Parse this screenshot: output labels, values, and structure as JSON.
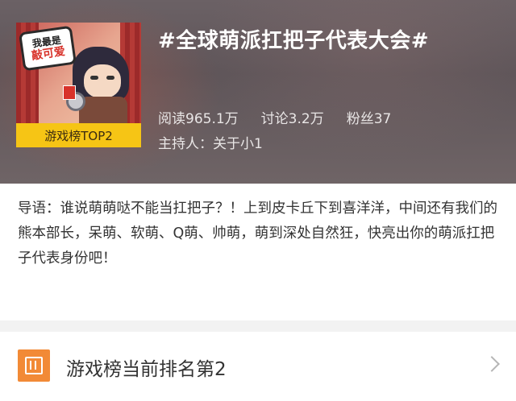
{
  "header": {
    "title": "#全球萌派扛把子代表大会#",
    "cover": {
      "bubble_line1": "我最是",
      "bubble_line2": "敲可爱",
      "rank_badge": "游戏榜TOP2"
    },
    "stats": {
      "reads": "阅读965.1万",
      "discussions": "讨论3.2万",
      "fans": "粉丝37"
    },
    "host": "主持人：关于小1"
  },
  "intro": {
    "text": "导语：谁说萌萌哒不能当扛把子？！上到皮卡丘下到喜洋洋，中间还有我们的熊本部长，呆萌、软萌、Q萌、帅萌，萌到深处自然狂，快亮出你的萌派扛把子代表身份吧！"
  },
  "ranking": {
    "label": "游戏榜当前排名第2",
    "icon": "ranking-icon",
    "chevron": "chevron-right-icon"
  },
  "colors": {
    "accent_yellow": "#f6c515",
    "accent_orange": "#f28a36",
    "header_bg": "#625a5d"
  }
}
